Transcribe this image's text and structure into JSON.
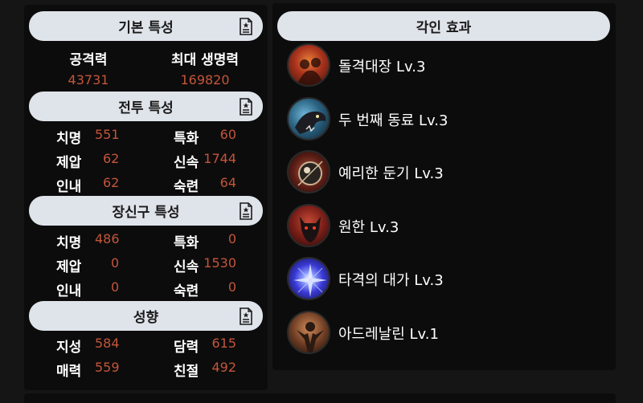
{
  "basic": {
    "title": "기본 특성",
    "attack_label": "공격력",
    "attack_value": "43731",
    "maxhp_label": "최대 생명력",
    "maxhp_value": "169820"
  },
  "combat": {
    "title": "전투 특성",
    "crit_label": "치명",
    "crit_value": "551",
    "spec_label": "특화",
    "spec_value": "60",
    "dom_label": "제압",
    "dom_value": "62",
    "swift_label": "신속",
    "swift_value": "1744",
    "end_label": "인내",
    "end_value": "62",
    "exp_label": "숙련",
    "exp_value": "64"
  },
  "accessory": {
    "title": "장신구 특성",
    "crit_label": "치명",
    "crit_value": "486",
    "spec_label": "특화",
    "spec_value": "0",
    "dom_label": "제압",
    "dom_value": "0",
    "swift_label": "신속",
    "swift_value": "1530",
    "end_label": "인내",
    "end_value": "0",
    "exp_label": "숙련",
    "exp_value": "0"
  },
  "tendency": {
    "title": "성향",
    "int_label": "지성",
    "int_value": "584",
    "courage_label": "담력",
    "courage_value": "615",
    "charm_label": "매력",
    "charm_value": "559",
    "kind_label": "친절",
    "kind_value": "492"
  },
  "engravings": {
    "title": "각인 효과",
    "items": [
      {
        "name": "돌격대장 Lv.3",
        "icon": "charge-commander-icon"
      },
      {
        "name": "두 번째 동료 Lv.3",
        "icon": "second-companion-icon"
      },
      {
        "name": "예리한 둔기 Lv.3",
        "icon": "keen-blunt-weapon-icon"
      },
      {
        "name": "원한 Lv.3",
        "icon": "grudge-icon"
      },
      {
        "name": "타격의 대가 Lv.3",
        "icon": "hit-master-icon"
      },
      {
        "name": "아드레날린 Lv.1",
        "icon": "adrenaline-icon"
      }
    ]
  },
  "colors": {
    "value_accent": "#c4553a",
    "header_bg": "#dfe3ea",
    "panel_bg": "#0c0c0c",
    "page_bg": "#151515"
  }
}
